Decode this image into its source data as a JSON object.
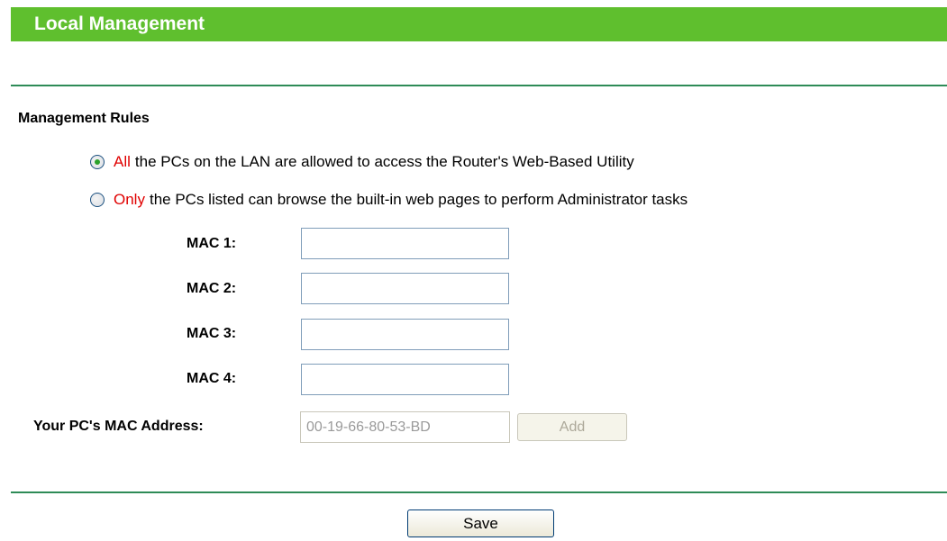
{
  "header": {
    "title": "Local Management"
  },
  "section": {
    "title": "Management Rules"
  },
  "rules": {
    "option_all": {
      "highlight": "All",
      "text": "the PCs on the LAN are allowed to access the Router's Web-Based Utility",
      "selected": true
    },
    "option_only": {
      "highlight": "Only",
      "text": "the PCs listed can browse the built-in web pages to perform Administrator tasks",
      "selected": false
    }
  },
  "mac_fields": [
    {
      "label": "MAC 1:",
      "value": ""
    },
    {
      "label": "MAC 2:",
      "value": ""
    },
    {
      "label": "MAC 3:",
      "value": ""
    },
    {
      "label": "MAC 4:",
      "value": ""
    }
  ],
  "pc_mac": {
    "label": "Your PC's MAC Address:",
    "value": "00-19-66-80-53-BD"
  },
  "buttons": {
    "add": "Add",
    "save": "Save"
  },
  "colors": {
    "header_bg": "#5fbf2e",
    "divider": "#2e8b57",
    "highlight": "#e00000"
  }
}
